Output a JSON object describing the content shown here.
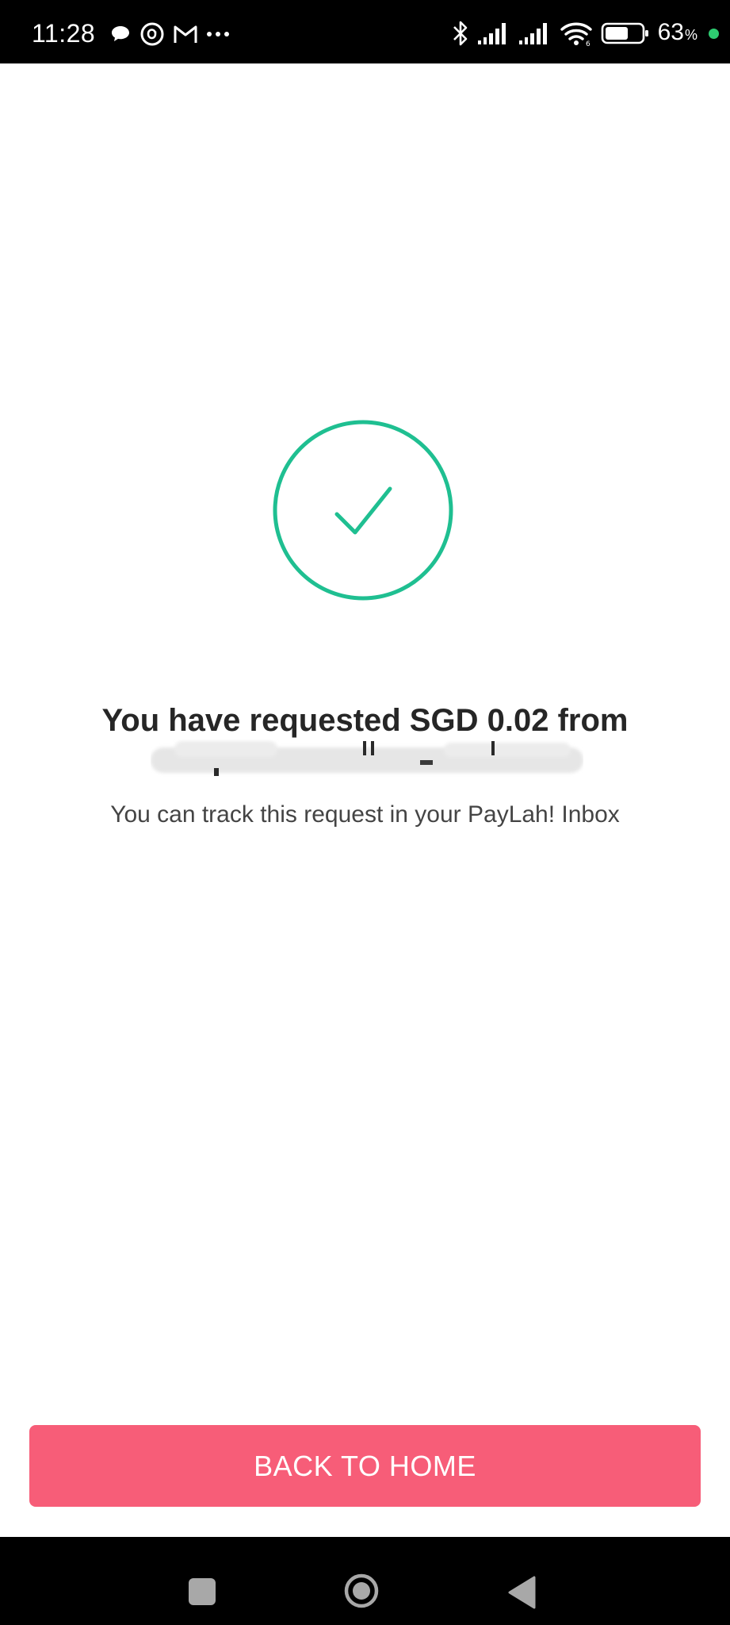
{
  "status_bar": {
    "time": "11:28",
    "battery_percent": "63",
    "percent_sign": "%",
    "left_icons": [
      "chat-bubble-icon",
      "threads-icon",
      "gmail-icon",
      "more-dots-icon"
    ],
    "right_icons": [
      "bluetooth-icon",
      "signal-icon",
      "signal-icon",
      "wifi-icon",
      "battery-icon"
    ],
    "battery_level": 0.63
  },
  "confirmation": {
    "icon": "check-circle-icon",
    "accent_color": "#1fbf91",
    "title": "You have requested SGD 0.02 from",
    "subtitle": "You can track this request in your PayLah! Inbox"
  },
  "actions": {
    "back_home_label": "BACK TO HOME",
    "button_color": "#f75d78"
  },
  "nav_bar": {
    "icons": [
      "recent-apps-icon",
      "home-icon",
      "back-icon"
    ]
  }
}
